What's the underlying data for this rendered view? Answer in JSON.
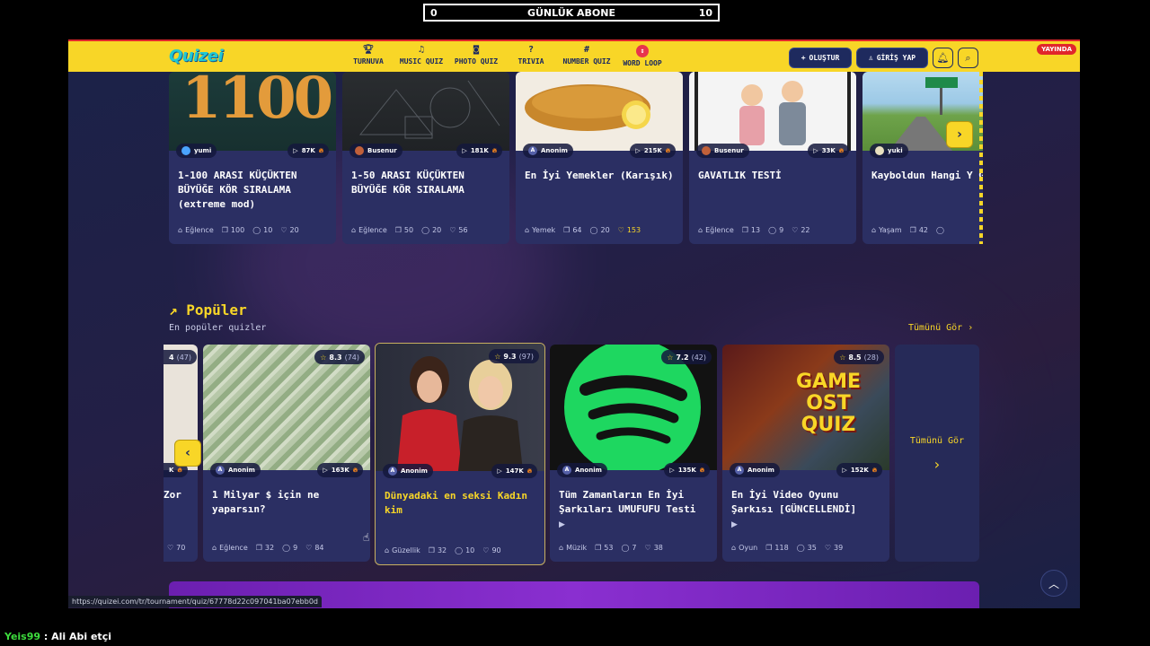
{
  "stream": {
    "sub_left": "0",
    "sub_title": "GÜNLÜK ABONE",
    "sub_right": "10",
    "chat_user": "Yeis99",
    "chat_msg": " : Ali Abi etçi"
  },
  "nav": {
    "logo": "Quizei",
    "items": [
      {
        "label": "TURNUVA",
        "icon": "trophy-icon"
      },
      {
        "label": "MUSIC QUIZ",
        "icon": "music-icon"
      },
      {
        "label": "PHOTO QUIZ",
        "icon": "camera-icon"
      },
      {
        "label": "TRIVIA",
        "icon": "question-icon"
      },
      {
        "label": "NUMBER QUIZ",
        "icon": "hash-icon"
      },
      {
        "label": "WORD LOOP",
        "icon": "loop-icon"
      }
    ],
    "create_label": "OLUŞTUR",
    "login_label": "GİRİŞ YAP",
    "live_label": "YAYINDA"
  },
  "top_cards": [
    {
      "author": "yumi",
      "views": "87K",
      "title": "1-100 ARASI KÜÇÜKTEN BÜYÜĞE KÖR SIRALAMA (extreme mod)",
      "category": "Eğlence",
      "questions": "100",
      "comments": "10",
      "likes": "20",
      "image_text": "1100"
    },
    {
      "author": "Busenur",
      "views": "181K",
      "title": "1-50 ARASI KÜÇÜKTEN BÜYÜĞE KÖR SIRALAMA",
      "category": "Eğlence",
      "questions": "50",
      "comments": "20",
      "likes": "56"
    },
    {
      "author": "Anonim",
      "views": "215K",
      "title": "En İyi Yemekler (Karışık)",
      "category": "Yemek",
      "questions": "64",
      "comments": "20",
      "likes": "153"
    },
    {
      "author": "Busenur",
      "views": "33K",
      "title": "GAVATLIK TESTİ",
      "category": "Eğlence",
      "questions": "13",
      "comments": "9",
      "likes": "22"
    },
    {
      "author": "yuki",
      "views": "",
      "title": "Kayboldun Hangi Y Gidersin?",
      "category": "Yaşam",
      "questions": "42",
      "comments": "",
      "likes": ""
    }
  ],
  "popular": {
    "title": "Popüler",
    "subtitle": "En popüler quizler",
    "see_all": "Tümünü Gör",
    "see_all_card": "Tümünü Gör",
    "partial_card": {
      "rating": "4",
      "rating_count": "(47)",
      "views": "K",
      "title": "Zor",
      "likes": "70"
    },
    "cards": [
      {
        "rating": "8.3",
        "rating_count": "(74)",
        "author": "Anonim",
        "views": "163K",
        "title": "1 Milyar $ için ne yaparsın?",
        "category": "Eğlence",
        "questions": "32",
        "comments": "9",
        "likes": "84"
      },
      {
        "rating": "9.3",
        "rating_count": "(97)",
        "author": "Anonim",
        "views": "147K",
        "title": "Dünyadaki en seksi Kadın kim",
        "category": "Güzellik",
        "questions": "32",
        "comments": "10",
        "likes": "90"
      },
      {
        "rating": "7.2",
        "rating_count": "(42)",
        "author": "Anonim",
        "views": "135K",
        "title": "Tüm Zamanların En İyi Şarkıları UMUFUFU Testi",
        "category": "Müzik",
        "questions": "53",
        "comments": "7",
        "likes": "38"
      },
      {
        "rating": "8.5",
        "rating_count": "(28)",
        "author": "Anonim",
        "views": "152K",
        "title": "En İyi Video Oyunu Şarkısı [GÜNCELLENDİ]",
        "category": "Oyun",
        "questions": "118",
        "comments": "35",
        "likes": "39",
        "image_text_1": "GAME",
        "image_text_2": "OST",
        "image_text_3": "QUIZ"
      }
    ]
  },
  "status_url": "https://quizei.com/tr/tournament/quiz/67778d22c097041ba07ebb0d",
  "colors": {
    "accent": "#f8d627",
    "nav_dark": "#1e2a5e",
    "live": "#e1262b",
    "card_bg": "#2b2f63"
  }
}
